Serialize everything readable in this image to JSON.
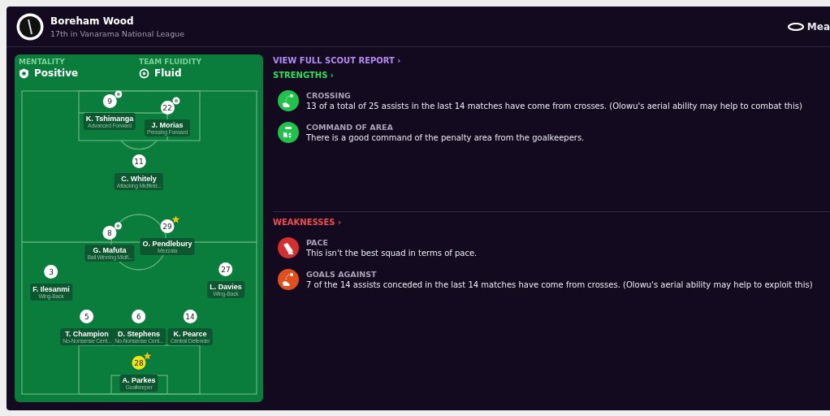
{
  "club": {
    "name": "Boreham Wood",
    "subtitle": "17th in Vanarama National League"
  },
  "top_right": {
    "label": "Mea"
  },
  "tactics": {
    "mentality": {
      "label": "MENTALITY",
      "value": "Positive"
    },
    "fluidity": {
      "label": "TEAM FLUIDITY",
      "value": "Fluid"
    },
    "players": [
      {
        "number": "9",
        "name": "K. Tshimanga",
        "role": "Advanced Forward",
        "kind": "ball",
        "highlighted": false
      },
      {
        "number": "22",
        "name": "J. Morias",
        "role": "Pressing Forward",
        "kind": "ball",
        "highlighted": false
      },
      {
        "number": "11",
        "name": "C. Whitely",
        "role": "Attacking Midfield...",
        "highlighted": false
      },
      {
        "number": "8",
        "name": "G. Mafuta",
        "role": "Ball Winning Midfi...",
        "kind": "ball",
        "highlighted": false
      },
      {
        "number": "29",
        "name": "O. Pendlebury",
        "role": "Mezzala",
        "kind": "star",
        "highlighted": false
      },
      {
        "number": "3",
        "name": "F. Ilesanmi",
        "role": "Wing-Back",
        "highlighted": false
      },
      {
        "number": "27",
        "name": "L. Davies",
        "role": "Wing-Back",
        "highlighted": false
      },
      {
        "number": "5",
        "name": "T. Champion",
        "role": "No-Nonsense Cent...",
        "highlighted": false
      },
      {
        "number": "6",
        "name": "D. Stephens",
        "role": "No-Nonsense Cent...",
        "highlighted": false
      },
      {
        "number": "14",
        "name": "K. Pearce",
        "role": "Central Defender",
        "highlighted": false
      },
      {
        "number": "28",
        "name": "A. Parkes",
        "role": "Goalkeeper",
        "kind": "star",
        "highlighted": true
      }
    ]
  },
  "report_link": "VIEW FULL SCOUT REPORT ›",
  "sections": [
    {
      "kind": "strengths",
      "title": "STRENGTHS ›",
      "items": [
        {
          "kind": "crossing",
          "color": "#1fc24a",
          "title": "CROSSING",
          "text": "13 of a total of 25 assists in the last 14 matches have come from crosses. (Olowu's aerial ability may help to combat this)"
        },
        {
          "kind": "command",
          "color": "#1fc24a",
          "title": "COMMAND OF AREA",
          "text": "There is a good command of the penalty area from the goalkeepers."
        }
      ]
    },
    {
      "kind": "weaknesses",
      "title": "WEAKNESSES ›",
      "items": [
        {
          "kind": "pace",
          "color": "#d52f2f",
          "title": "PACE",
          "text": "This isn't the best squad in terms of pace."
        },
        {
          "kind": "crossing",
          "color": "#e0501e",
          "title": "GOALS AGAINST",
          "text": "7 of the 14 assists conceded in the last 14 matches have come from crosses. (Olowu's aerial ability may help to exploit this)"
        }
      ]
    }
  ]
}
